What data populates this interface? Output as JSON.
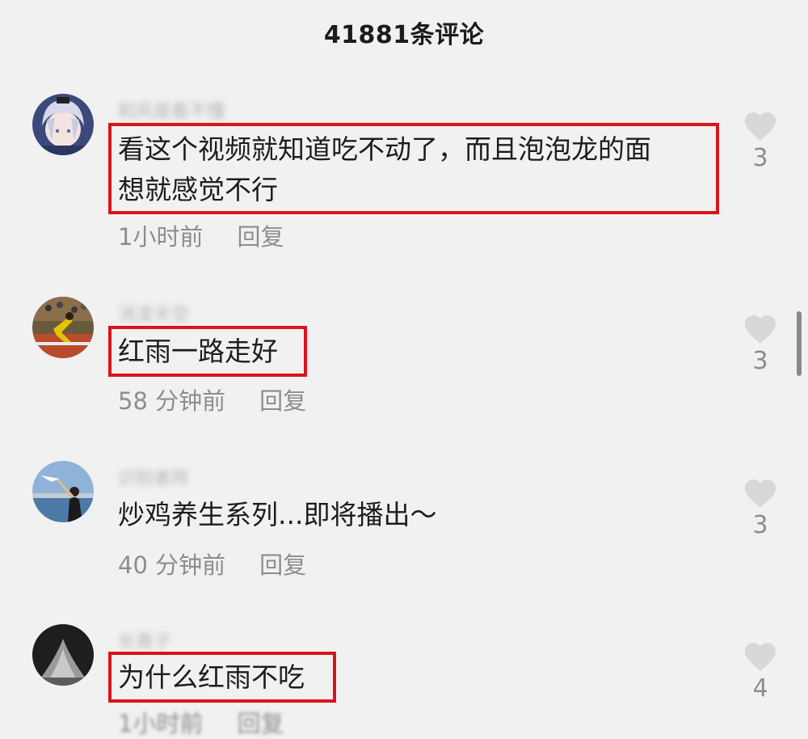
{
  "header": {
    "title": "41881条评论"
  },
  "comments": [
    {
      "username": "和风是看不懂",
      "text_line1": "看这个视频就知道吃不动了，而且泡泡龙的面",
      "text_line2": "想就感觉不行",
      "time": "1小时前",
      "reply_label": "回复",
      "likes": "3",
      "highlighted": true
    },
    {
      "username": "消凌天空",
      "text_line1": "红雨一路走好",
      "time": "58 分钟前",
      "reply_label": "回复",
      "likes": "3",
      "highlighted": true
    },
    {
      "username": "识别者阵",
      "text_line1": "炒鸡养生系列...即将播出～",
      "time": "40 分钟前",
      "reply_label": "回复",
      "likes": "3",
      "highlighted": false
    },
    {
      "username": "长青子",
      "text_line1": "为什么红雨不吃",
      "time": "1小时前",
      "reply_label": "回复",
      "likes": "4",
      "highlighted": true
    }
  ],
  "colors": {
    "background": "#f1f1f1",
    "highlight_border": "#d9141b",
    "muted_text": "#8d8d8d",
    "heart": "#d8d8d8"
  }
}
